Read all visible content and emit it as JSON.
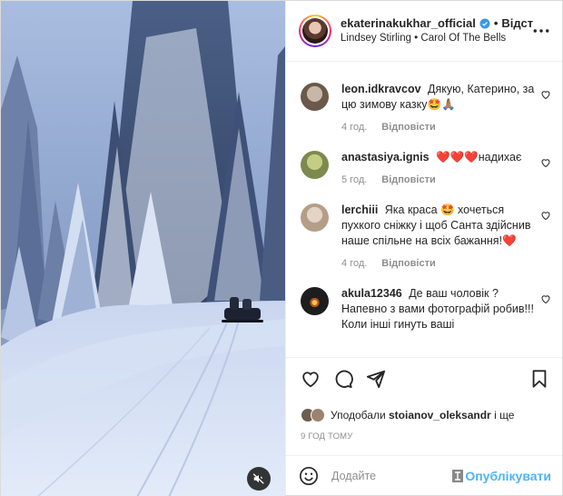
{
  "header": {
    "username": "ekaterinakukhar_official",
    "follow_label": "Відстежувати",
    "follow_visible": "Відст",
    "separator": "•",
    "music": "Lindsey Stirling • Carol Of The Bells",
    "more_icon": "more-dots-icon"
  },
  "comments": [
    {
      "user": "leon.idkravcov",
      "text": "Дякую, Катерино, за цю зимову казку🤩🙏🏽",
      "time": "4 год.",
      "reply": "Відповісти",
      "avatar_color": "#7a6a5c"
    },
    {
      "user": "anastasiya.ignis",
      "text": "❤️❤️❤️надихає",
      "time": "5 год.",
      "reply": "Відповісти",
      "avatar_color": "#9aa36a"
    },
    {
      "user": "lerchiii",
      "text": "Яка краса 🤩 хочеться пухкого сніжку і щоб Санта здійснив наше спільне на всіх бажання!❤️",
      "time": "4 год.",
      "reply": "Відповісти",
      "avatar_color": "#c9b8a8"
    },
    {
      "user": "akula12346",
      "text": "Де ваш чоловік ? Напевно з вами фотографій робив!!! Коли інші гинуть ваші",
      "time": "",
      "reply": "",
      "avatar_color": "#1d1d1d"
    }
  ],
  "likes": {
    "prefix": "Уподобали",
    "user": "stoianov_oleksandr",
    "suffix": "і ще"
  },
  "time_ago": "9 ГОД ТОМУ",
  "add_comment": {
    "placeholder": "Додайте",
    "publish_label": "Опублікувати"
  },
  "colors": {
    "accent": "#0095f6",
    "text": "#262626",
    "muted": "#8e8e8e",
    "heart_red": "#ed4956"
  }
}
